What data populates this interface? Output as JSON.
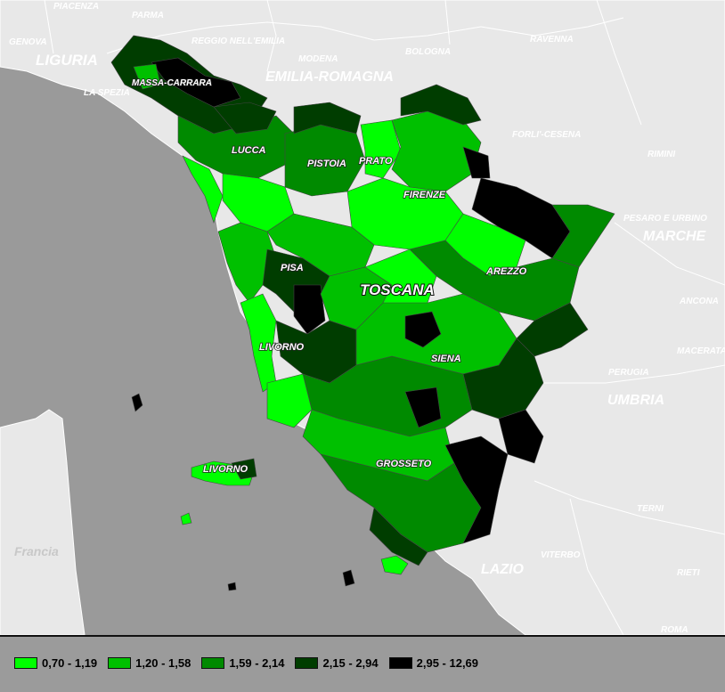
{
  "map": {
    "region_title": "TOSCANA",
    "neighbor_regions": [
      {
        "id": "liguria",
        "text": "LIGURIA"
      },
      {
        "id": "emilia",
        "text": "EMILIA-ROMAGNA"
      },
      {
        "id": "marche",
        "text": "MARCHE"
      },
      {
        "id": "umbria",
        "text": "UMBRIA"
      },
      {
        "id": "lazio",
        "text": "LAZIO"
      }
    ],
    "neighbor_places": [
      {
        "id": "piacenza",
        "text": "PIACENZA"
      },
      {
        "id": "parma",
        "text": "PARMA"
      },
      {
        "id": "genova",
        "text": "GENOVA"
      },
      {
        "id": "reggio",
        "text": "REGGIO NELL'EMILIA"
      },
      {
        "id": "modena",
        "text": "MODENA"
      },
      {
        "id": "bologna",
        "text": "BOLOGNA"
      },
      {
        "id": "ravenna",
        "text": "RAVENNA"
      },
      {
        "id": "laspezia",
        "text": "LA SPEZIA"
      },
      {
        "id": "forli",
        "text": "FORLI'-CESENA"
      },
      {
        "id": "rimini",
        "text": "RIMINI"
      },
      {
        "id": "pesaro",
        "text": "PESARO E URBINO"
      },
      {
        "id": "ancona",
        "text": "ANCONA"
      },
      {
        "id": "macerata",
        "text": "MACERATA"
      },
      {
        "id": "perugia",
        "text": "PERUGIA"
      },
      {
        "id": "terni",
        "text": "TERNI"
      },
      {
        "id": "viterbo",
        "text": "VITERBO"
      },
      {
        "id": "rieti",
        "text": "RIETI"
      },
      {
        "id": "roma",
        "text": "ROMA"
      }
    ],
    "sea_label": "Francia",
    "provinces": [
      {
        "id": "massa",
        "text": "MASSA-CARRARA"
      },
      {
        "id": "lucca",
        "text": "LUCCA"
      },
      {
        "id": "pistoia",
        "text": "PISTOIA"
      },
      {
        "id": "prato",
        "text": "PRATO"
      },
      {
        "id": "firenze",
        "text": "FIRENZE"
      },
      {
        "id": "arezzo",
        "text": "AREZZO"
      },
      {
        "id": "pisa",
        "text": "PISA"
      },
      {
        "id": "livorno",
        "text": "LIVORNO"
      },
      {
        "id": "siena",
        "text": "SIENA"
      },
      {
        "id": "grosseto",
        "text": "GROSSETO"
      },
      {
        "id": "livorno2",
        "text": "LIVORNO"
      }
    ]
  },
  "legend": {
    "classes": [
      {
        "label": "0,70 - 1,19",
        "color": "#00ff00"
      },
      {
        "label": "1,20 - 1,58",
        "color": "#00c000"
      },
      {
        "label": "1,59 - 2,14",
        "color": "#008a00"
      },
      {
        "label": "2,15 - 2,94",
        "color": "#003d00"
      },
      {
        "label": "2,95 - 12,69",
        "color": "#000000"
      }
    ]
  },
  "colors": {
    "sea": "#9a9a9a",
    "land": "#e8e8e8",
    "border": "#ffffff"
  }
}
